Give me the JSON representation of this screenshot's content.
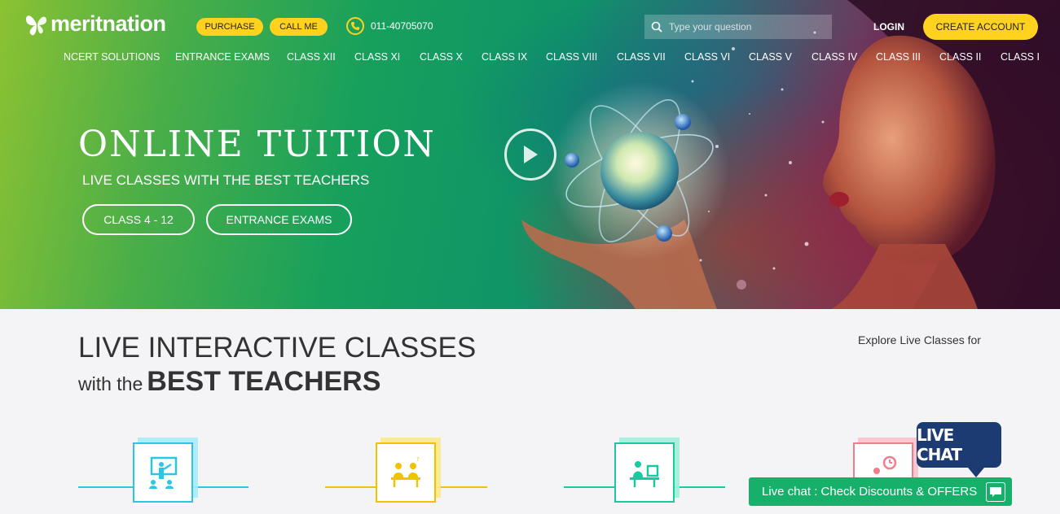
{
  "header": {
    "logo_text": "meritnation",
    "purchase_label": "PURCHASE",
    "callme_label": "CALL ME",
    "phone_number": "011-40705070",
    "search_placeholder": "Type your question",
    "login_label": "LOGIN",
    "create_account_label": "CREATE ACCOUNT"
  },
  "nav": {
    "items": [
      {
        "label": "NCERT SOLUTIONS"
      },
      {
        "label": "ENTRANCE EXAMS"
      },
      {
        "label": "CLASS XII"
      },
      {
        "label": "CLASS XI"
      },
      {
        "label": "CLASS X"
      },
      {
        "label": "CLASS IX"
      },
      {
        "label": "CLASS VIII"
      },
      {
        "label": "CLASS VII"
      },
      {
        "label": "CLASS VI"
      },
      {
        "label": "CLASS V"
      },
      {
        "label": "CLASS IV"
      },
      {
        "label": "CLASS III"
      },
      {
        "label": "CLASS II"
      },
      {
        "label": "CLASS I"
      }
    ]
  },
  "hero": {
    "title": "ONLINE TUITION",
    "subtitle": "LIVE CLASSES WITH THE BEST TEACHERS",
    "button_class": "CLASS 4 - 12",
    "button_exams": "ENTRANCE EXAMS"
  },
  "section": {
    "title": "LIVE INTERACTIVE CLASSES",
    "subtitle_prefix": "with the",
    "subtitle_bold": "BEST TEACHERS",
    "explore_text": "Explore Live Classes for"
  },
  "features": [
    {
      "icon": "teacher-board-icon",
      "color": "#29c6e6"
    },
    {
      "icon": "students-desk-icon",
      "color": "#f2c200"
    },
    {
      "icon": "student-computer-icon",
      "color": "#19c9a0"
    },
    {
      "icon": "student-clock-icon",
      "color": "#f07c8c"
    }
  ],
  "chat": {
    "badge_label": "LIVE CHAT",
    "bar_text": "Live chat : Check Discounts & OFFERS"
  },
  "colors": {
    "accent_yellow": "#ffd21f",
    "chat_green": "#17b06b",
    "chat_badge_blue": "#1c3b73"
  }
}
